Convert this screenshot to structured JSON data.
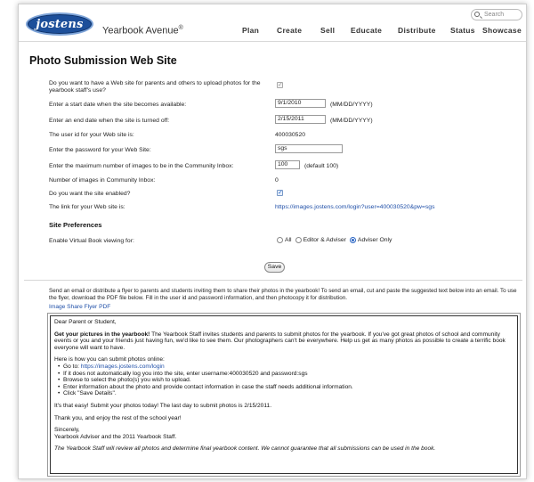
{
  "header": {
    "logo_text": "jostens",
    "brand": "Yearbook Avenue",
    "brand_mark": "®",
    "search_placeholder": "Search",
    "nav": [
      "Plan",
      "Create",
      "Sell",
      "Educate",
      "Distribute",
      "Status",
      "Showcase"
    ]
  },
  "page_title": "Photo Submission Web Site",
  "form": {
    "want_site_label": "Do you want to have a Web site for parents and others to upload photos for the yearbook staff's use?",
    "start_date_label": "Enter a start date when the site becomes available:",
    "start_date_value": "9/1/2010",
    "start_date_hint": "(MM/DD/YYYY)",
    "end_date_label": "Enter an end date when the site is turned off:",
    "end_date_value": "2/15/2011",
    "end_date_hint": "(MM/DD/YYYY)",
    "user_id_label": "The user id for your Web site is:",
    "user_id_value": "400030520",
    "password_label": "Enter the password for your Web Site:",
    "password_value": "sgs",
    "max_images_label": "Enter the maximum number of images to be in the Community Inbox:",
    "max_images_value": "100",
    "max_images_hint": "(default 100)",
    "num_images_label": "Number of images in Community Inbox:",
    "num_images_value": "0",
    "enabled_label": "Do you want the site enabled?",
    "link_label": "The link for your Web site is:",
    "link_value": "https://images.jostens.com/login?user=400030520&pw=sgs"
  },
  "preferences": {
    "title": "Site Preferences",
    "virtual_book_label": "Enable Virtual Book viewing for:",
    "options": [
      "All",
      "Editor & Adviser",
      "Adviser Only"
    ],
    "selected": "Adviser Only"
  },
  "save_label": "Save",
  "intro": "Send an email or distribute a flyer to parents and students inviting them to share their photos in the yearbook! To send an email, cut and paste the suggested text below into an email. To use the flyer, download the PDF file below. Fill in the user id and password information, and then photocopy it for distribution.",
  "flyer_link": "Image Share Flyer PDF",
  "letter": {
    "greeting": "Dear Parent or Student,",
    "headline": "Get your pictures in the yearbook!",
    "body1": " The Yearbook Staff invites students and parents to submit photos for the yearbook. If you've got great photos of school and community events or you and your friends just having fun, we'd like to see them. Our photographers can't be everywhere. Help us get as many photos as possible to create a terrific book everyone will want to have.",
    "how_to": "Here is how you can submit photos online:",
    "step1_prefix": "Go to: ",
    "step1_link": "https://images.jostens.com/login",
    "step2": "If it does not automatically log you into the site, enter username:400030520 and password:sgs",
    "step3": "Browse to select the photo(s) you wish to upload.",
    "step4": "Enter information about the photo and provide contact information in case the staff needs additional information.",
    "step5": "Click \"Save Details\".",
    "easy": "It's that easy! Submit your photos today! The last day to submit photos is 2/15/2011.",
    "thanks": "Thank you, and enjoy the rest of the school year!",
    "sign1": "Sincerely,",
    "sign2": "Yearbook Adviser and the 2011 Yearbook Staff.",
    "disclaimer": "The Yearbook Staff will review all photos and determine final yearbook content. We cannot guarantee that all submissions can be used in the book."
  }
}
